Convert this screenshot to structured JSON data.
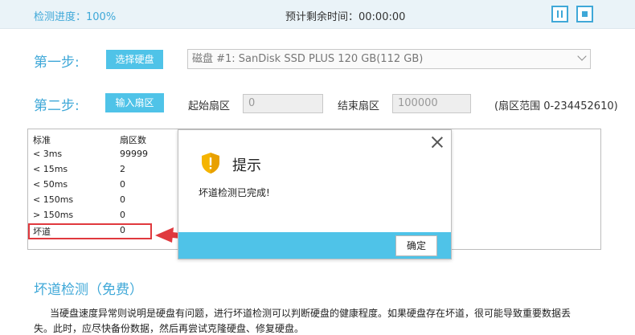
{
  "header": {
    "progress": "检测进度：100%",
    "time_remaining": "预计剩余时间：00:00:00"
  },
  "step1": {
    "label": "第一步:",
    "button": "选择硬盘",
    "disk": "磁盘 #1: SanDisk SSD PLUS 120 GB(112 GB)"
  },
  "step2": {
    "label": "第二步:",
    "button": "输入扇区",
    "start_label": "起始扇区",
    "start_value": "0",
    "end_label": "结束扇区",
    "end_value": "100000",
    "range": "(扇区范围 0-234452610)"
  },
  "stats": {
    "headers": [
      "标准",
      "扇区数"
    ],
    "rows": [
      [
        "< 3ms",
        "99999"
      ],
      [
        "< 15ms",
        "2"
      ],
      [
        "< 50ms",
        "0"
      ],
      [
        "< 150ms",
        "0"
      ],
      [
        "> 150ms",
        "0"
      ],
      [
        "坏道",
        "0"
      ]
    ]
  },
  "dialog": {
    "title": "提示",
    "message": "坏道检测已完成!",
    "ok": "确定"
  },
  "section": {
    "title": "坏道检测（免费）",
    "line1": "当硬盘速度异常则说明是硬盘有问题，进行坏道检测可以判断硬盘的健康程度。如果硬盘存在坏道，很可能导致重要数据丢",
    "line2": "失。此时，应尽快备份数据，然后再尝试克隆硬盘、修复硬盘。"
  },
  "colors": {
    "accent": "#3fa8d8",
    "button": "#4fc3e8",
    "highlight": "#e0393e",
    "warning": "#f5b400"
  },
  "icons": {
    "pause": "pause-icon",
    "stop": "stop-icon",
    "close": "close-icon",
    "shield": "shield-warning-icon"
  }
}
